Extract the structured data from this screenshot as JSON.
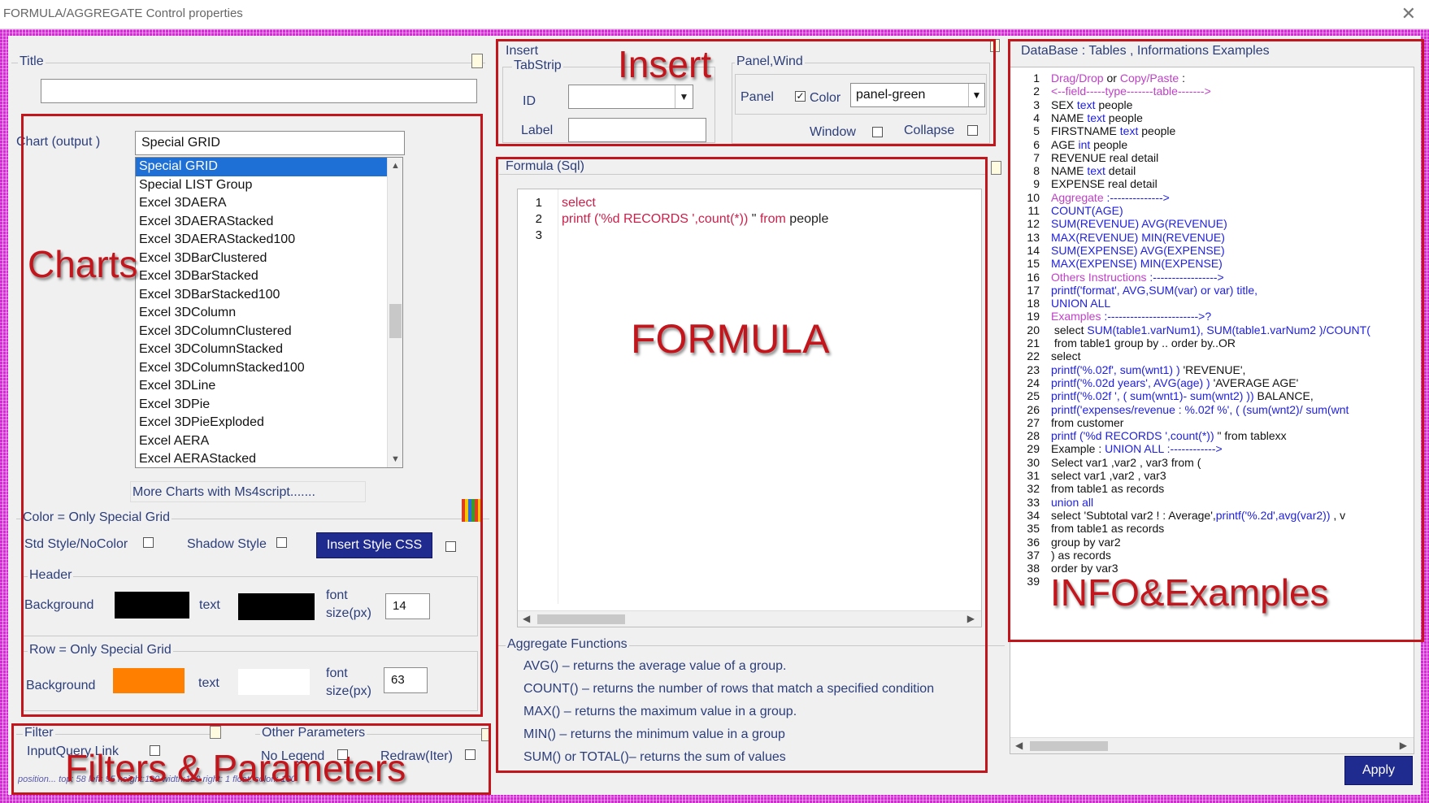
{
  "window": {
    "title": "FORMULA/AGGREGATE Control properties",
    "close_glyph": "✕"
  },
  "title_group": {
    "label": "Title",
    "value": ""
  },
  "charts": {
    "output_label": "Chart (output )",
    "output_value": "Special GRID",
    "items": [
      "Special GRID",
      "Special LIST Group",
      "Excel  3DAERA",
      "Excel 3DAERAStacked",
      "Excel 3DAERAStacked100",
      "Excel  3DBarClustered",
      "Excel 3DBarStacked",
      "Excel 3DBarStacked100",
      "Excel 3DColumn",
      "Excel 3DColumnClustered",
      "Excel 3DColumnStacked",
      "Excel 3DColumnStacked100",
      "Excel 3DLine",
      "Excel 3DPie",
      "Excel 3DPieExploded",
      "Excel AERA",
      "Excel AERAStacked"
    ],
    "selected_index": 0,
    "more_link": "More Charts with Ms4script......."
  },
  "color_group": {
    "label": "Color = Only Special Grid",
    "std_style": "Std Style/NoColor",
    "shadow_style": "Shadow Style",
    "insert_css_button": "Insert Style CSS",
    "header_label": "Header",
    "background_label": "Background",
    "text_label": "text",
    "font_label_1": "font",
    "font_label_2": "size(px)",
    "header_font_size": "14",
    "header_bg": "#000000",
    "header_text": "#000000",
    "row_label": "Row = Only Special Grid",
    "row_font_size": "63",
    "row_bg": "#ff8000",
    "row_text": "#ffffff"
  },
  "filter": {
    "label": "Filter",
    "input_query_link": "InputQuery Link",
    "position_text": "position... top:  58 left: 95 height:120 width:120 right: 1 float: colon: 100"
  },
  "other_params": {
    "label": "Other Parameters",
    "no_legend": "No Legend",
    "redraw": "Redraw(Iter)"
  },
  "insert": {
    "label": "Insert",
    "tabstrip_label": "TabStrip",
    "id_label": "ID",
    "id_value": "",
    "label_label": "Label",
    "label_value": "",
    "panel_group_label": "Panel,Wind",
    "panel_label": "Panel",
    "color_label": "Color",
    "color_value": "panel-green",
    "window_label": "Window",
    "collapse_label": "Collapse"
  },
  "formula": {
    "label": "Formula (Sql)",
    "lines": [
      {
        "n": "1",
        "parts": [
          {
            "t": " select",
            "c": "kw"
          }
        ]
      },
      {
        "n": "2",
        "parts": [
          {
            "t": "printf ('%d RECORDS ',",
            "c": "kw"
          },
          {
            "t": "count(*))",
            "c": "kw"
          },
          {
            "t": "  \"  ",
            "c": "plain"
          },
          {
            "t": "from",
            "c": "kw"
          },
          {
            "t": " people",
            "c": "plain"
          }
        ]
      },
      {
        "n": "3",
        "parts": []
      }
    ]
  },
  "aggregate": {
    "label": "Aggregate Functions",
    "items": [
      "AVG() – returns the average value of a group.",
      "COUNT() – returns the number of rows that match a specified condition",
      "MAX() – returns the maximum value in a group.",
      "MIN() – returns the minimum value in a group",
      "SUM() or TOTAL()– returns the sum of values"
    ]
  },
  "info": {
    "header": "DataBase : Tables , Informations  Examples",
    "lines": [
      {
        "n": "1",
        "parts": [
          {
            "t": "Drag/Drop",
            "c": "c-purple"
          },
          {
            "t": " or ",
            "c": "c-black"
          },
          {
            "t": "Copy/Paste",
            "c": "c-purple"
          },
          {
            "t": " :",
            "c": "c-black"
          }
        ]
      },
      {
        "n": "2",
        "parts": [
          {
            "t": "<--field-----type-------table------->",
            "c": "c-purple"
          }
        ]
      },
      {
        "n": "3",
        "parts": [
          {
            "t": "SEX  ",
            "c": "c-black"
          },
          {
            "t": "text",
            "c": "c-blue"
          },
          {
            "t": "    people",
            "c": "c-black"
          }
        ]
      },
      {
        "n": "4",
        "parts": [
          {
            "t": "NAME  ",
            "c": "c-black"
          },
          {
            "t": "text",
            "c": "c-blue"
          },
          {
            "t": "    people",
            "c": "c-black"
          }
        ]
      },
      {
        "n": "5",
        "parts": [
          {
            "t": "FIRSTNAME   ",
            "c": "c-black"
          },
          {
            "t": "text",
            "c": "c-blue"
          },
          {
            "t": "    people",
            "c": "c-black"
          }
        ]
      },
      {
        "n": "6",
        "parts": [
          {
            "t": "AGE  ",
            "c": "c-black"
          },
          {
            "t": "int",
            "c": "c-blue"
          },
          {
            "t": "   people",
            "c": "c-black"
          }
        ]
      },
      {
        "n": "7",
        "parts": [
          {
            "t": "REVENUE  real    detail",
            "c": "c-black"
          }
        ]
      },
      {
        "n": "8",
        "parts": [
          {
            "t": "NAME  ",
            "c": "c-black"
          },
          {
            "t": "text",
            "c": "c-blue"
          },
          {
            "t": "    detail",
            "c": "c-black"
          }
        ]
      },
      {
        "n": "9",
        "parts": [
          {
            "t": "EXPENSE  real    detail",
            "c": "c-black"
          }
        ]
      },
      {
        "n": "10",
        "parts": [
          {
            "t": "Aggregate",
            "c": "c-purple"
          },
          {
            "t": " :-------------->",
            "c": "c-blue"
          }
        ]
      },
      {
        "n": "11",
        "parts": [
          {
            "t": "COUNT(AGE)",
            "c": "c-blue"
          }
        ]
      },
      {
        "n": "12",
        "parts": [
          {
            "t": "SUM(REVENUE)  AVG(REVENUE)",
            "c": "c-blue"
          }
        ]
      },
      {
        "n": "13",
        "parts": [
          {
            "t": "MAX(REVENUE)  MIN(REVENUE)",
            "c": "c-blue"
          }
        ]
      },
      {
        "n": "14",
        "parts": [
          {
            "t": "SUM(EXPENSE)  AVG(EXPENSE)",
            "c": "c-blue"
          }
        ]
      },
      {
        "n": "15",
        "parts": [
          {
            "t": "MAX(EXPENSE)  MIN(EXPENSE)",
            "c": "c-blue"
          }
        ]
      },
      {
        "n": "16",
        "parts": [
          {
            "t": "Others Instructions",
            "c": "c-purple"
          },
          {
            "t": "  :----------------->",
            "c": "c-blue"
          }
        ]
      },
      {
        "n": "17",
        "parts": [
          {
            "t": "printf('format', AVG,SUM(var) or var) title,",
            "c": "c-blue"
          }
        ]
      },
      {
        "n": "18",
        "parts": [
          {
            "t": "UNION ALL",
            "c": "c-blue"
          }
        ]
      },
      {
        "n": "19",
        "parts": [
          {
            "t": "Examples",
            "c": "c-purple"
          },
          {
            "t": "  :------------------------>?",
            "c": "c-blue"
          }
        ]
      },
      {
        "n": "20",
        "parts": [
          {
            "t": " select ",
            "c": "c-black"
          },
          {
            "t": "SUM(table1.varNum1), SUM(table1.varNum2 )/COUNT(",
            "c": "c-blue"
          }
        ]
      },
      {
        "n": "21",
        "parts": [
          {
            "t": " from table1 group by .. order by..OR",
            "c": "c-black"
          }
        ]
      },
      {
        "n": "22",
        "parts": [
          {
            "t": "select",
            "c": "c-black"
          }
        ]
      },
      {
        "n": "23",
        "parts": [
          {
            "t": "printf('%.02f',   sum(wnt1)  )",
            "c": "c-blue"
          },
          {
            "t": " 'REVENUE',",
            "c": "c-black"
          }
        ]
      },
      {
        "n": "24",
        "parts": [
          {
            "t": "printf('%.02d years',   AVG(age)  )",
            "c": "c-blue"
          },
          {
            "t": " 'AVERAGE AGE'",
            "c": "c-black"
          }
        ]
      },
      {
        "n": "25",
        "parts": [
          {
            "t": "printf('%.02f  ', (  sum(wnt1)- sum(wnt2)  ))",
            "c": "c-blue"
          },
          {
            "t": "  BALANCE,",
            "c": "c-black"
          }
        ]
      },
      {
        "n": "26",
        "parts": [
          {
            "t": "printf('expenses/revenue  : %.02f %', ( (sum(wnt2)/ sum(wnt",
            "c": "c-blue"
          }
        ]
      },
      {
        "n": "27",
        "parts": [
          {
            "t": "from customer",
            "c": "c-black"
          }
        ]
      },
      {
        "n": "28",
        "parts": [
          {
            "t": "printf ('%d RECORDS ',count(*))",
            "c": "c-blue"
          },
          {
            "t": "  \"  from tablexx",
            "c": "c-black"
          }
        ]
      },
      {
        "n": "29",
        "parts": [
          {
            "t": "Example : ",
            "c": "c-black"
          },
          {
            "t": "UNION ALL",
            "c": "c-blue"
          },
          {
            "t": " :------------>",
            "c": "c-blue"
          }
        ]
      },
      {
        "n": "30",
        "parts": [
          {
            "t": "Select   var1 ,var2 , var3 from (",
            "c": "c-black"
          }
        ]
      },
      {
        "n": "31",
        "parts": [
          {
            "t": "select var1 ,var2 , var3",
            "c": "c-black"
          }
        ]
      },
      {
        "n": "32",
        "parts": [
          {
            "t": "from table1 as records",
            "c": "c-black"
          }
        ]
      },
      {
        "n": "33",
        "parts": [
          {
            "t": "union all",
            "c": "c-blue"
          }
        ]
      },
      {
        "n": "34",
        "parts": [
          {
            "t": "select 'Subtotal var2 ! : Average',",
            "c": "c-black"
          },
          {
            "t": "printf('%.2d',avg(var2))",
            "c": "c-blue"
          },
          {
            "t": " ,   v",
            "c": "c-black"
          }
        ]
      },
      {
        "n": "35",
        "parts": [
          {
            "t": "from table1  as records",
            "c": "c-black"
          }
        ]
      },
      {
        "n": "36",
        "parts": [
          {
            "t": "group by var2",
            "c": "c-black"
          }
        ]
      },
      {
        "n": "37",
        "parts": [
          {
            "t": ") as records",
            "c": "c-black"
          }
        ]
      },
      {
        "n": "38",
        "parts": [
          {
            "t": "order  by  var3",
            "c": "c-black"
          }
        ]
      },
      {
        "n": "39",
        "parts": []
      }
    ]
  },
  "apply_button": "Apply",
  "annotations": {
    "charts": "Charts",
    "insert": "Insert",
    "formula": "FORMULA",
    "info": "INFO&Examples",
    "filters": "Filters & Parameters"
  }
}
